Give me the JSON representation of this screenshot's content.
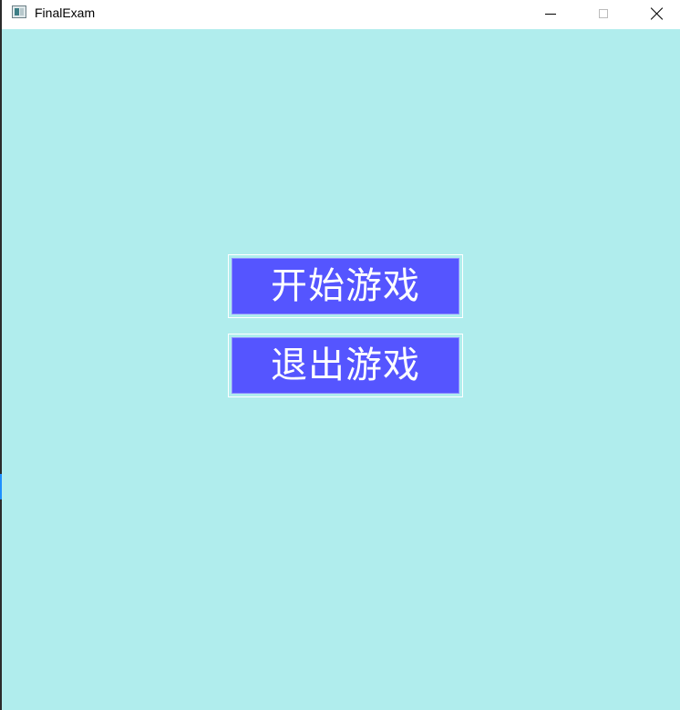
{
  "window": {
    "title": "FinalExam",
    "icon": "app-icon",
    "controls": {
      "minimize_icon": "minimize-icon",
      "maximize_icon": "maximize-icon",
      "close_icon": "close-icon"
    }
  },
  "menu": {
    "start_label": "开始游戏",
    "exit_label": "退出游戏"
  },
  "colors": {
    "background": "#b0eded",
    "button_fill": "#5555ff",
    "button_text": "#ffffff",
    "titlebar": "#ffffff"
  }
}
